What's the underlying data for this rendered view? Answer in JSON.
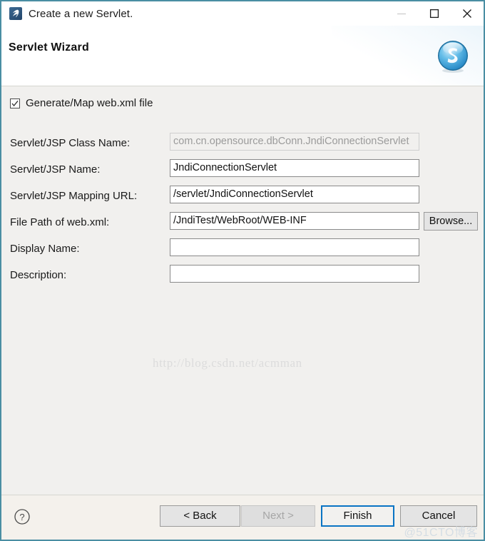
{
  "window": {
    "title": "Create a new Servlet.",
    "icon": "servlet-app-icon",
    "border_color": "#4a8ea3",
    "controls": {
      "minimize": "minimize-icon",
      "maximize": "maximize-icon",
      "close": "close-icon"
    }
  },
  "header": {
    "title": "Servlet Wizard",
    "logo": "blue-sphere-s-logo"
  },
  "content": {
    "checkbox": {
      "label": "Generate/Map web.xml file",
      "checked": true
    },
    "fields": [
      {
        "label": "Servlet/JSP Class Name:",
        "value": "com.cn.opensource.dbConn.JndiConnectionServlet",
        "placeholder": "",
        "disabled": true,
        "has_browse": false
      },
      {
        "label": "Servlet/JSP Name:",
        "value": "JndiConnectionServlet",
        "placeholder": "",
        "disabled": false,
        "has_browse": false
      },
      {
        "label": "Servlet/JSP Mapping URL:",
        "value": "/servlet/JndiConnectionServlet",
        "placeholder": "",
        "disabled": false,
        "has_browse": false
      },
      {
        "label": "File Path of web.xml:",
        "value": "/JndiTest/WebRoot/WEB-INF",
        "placeholder": "",
        "disabled": false,
        "has_browse": true,
        "browse_label": "Browse..."
      },
      {
        "label": "Display Name:",
        "value": "",
        "placeholder": "",
        "disabled": false,
        "has_browse": false
      },
      {
        "label": "Description:",
        "value": "",
        "placeholder": "",
        "disabled": false,
        "has_browse": false
      }
    ],
    "watermark_url": "http://blog.csdn.net/acmman"
  },
  "footer": {
    "help": "help-icon",
    "buttons": {
      "back": "< Back",
      "next": "Next >",
      "finish": "Finish",
      "cancel": "Cancel"
    },
    "default_button": "Finish",
    "default_button_color": "#0a74c4",
    "watermark": "@51CTO博客"
  }
}
